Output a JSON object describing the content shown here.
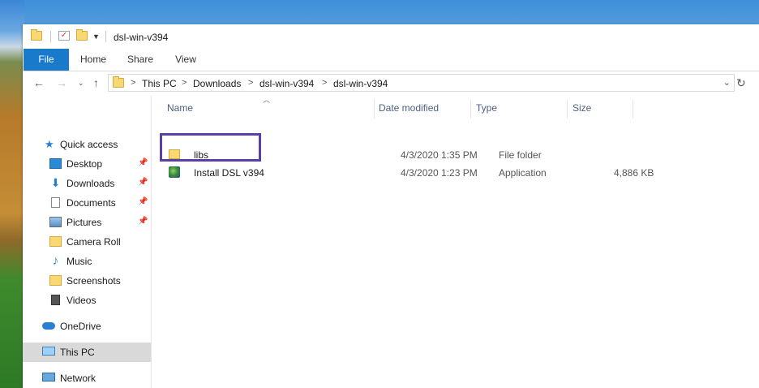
{
  "window": {
    "title": "dsl-win-v394"
  },
  "ribbon": {
    "tabs": [
      "File",
      "Home",
      "Share",
      "View"
    ]
  },
  "address": {
    "crumbs": [
      "This PC",
      "Downloads",
      "dsl-win-v394",
      "dsl-win-v394"
    ],
    "separator": ">"
  },
  "nav": {
    "quick_access": "Quick access",
    "items": [
      {
        "label": "Desktop",
        "icon": "desktop-icon",
        "pinned": true
      },
      {
        "label": "Downloads",
        "icon": "download-icon",
        "pinned": true
      },
      {
        "label": "Documents",
        "icon": "document-icon",
        "pinned": true
      },
      {
        "label": "Pictures",
        "icon": "pictures-icon",
        "pinned": true
      },
      {
        "label": "Camera Roll",
        "icon": "folder-icon",
        "pinned": false
      },
      {
        "label": "Music",
        "icon": "music-icon",
        "pinned": false
      },
      {
        "label": "Screenshots",
        "icon": "folder-icon",
        "pinned": false
      },
      {
        "label": "Videos",
        "icon": "videos-icon",
        "pinned": false
      }
    ],
    "onedrive": "OneDrive",
    "this_pc": "This PC",
    "network": "Network"
  },
  "columns": {
    "name": "Name",
    "date": "Date modified",
    "type": "Type",
    "size": "Size"
  },
  "files": [
    {
      "name": "libs",
      "date": "4/3/2020 1:35 PM",
      "type": "File folder",
      "size": "",
      "icon": "folder-icon"
    },
    {
      "name": "Install DSL v394",
      "date": "4/3/2020 1:23 PM",
      "type": "Application",
      "size": "4,886 KB",
      "icon": "installer-app-icon"
    }
  ],
  "colors": {
    "accent": "#1979ca",
    "highlight": "#5b3fa8",
    "selected_nav": "#d9d9d9"
  }
}
